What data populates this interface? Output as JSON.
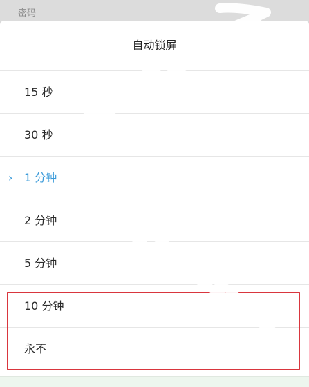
{
  "background": {
    "label": "密码"
  },
  "dialog": {
    "title": "自动锁屏",
    "options": [
      {
        "label": "15 秒",
        "selected": false
      },
      {
        "label": "30 秒",
        "selected": false
      },
      {
        "label": "1 分钟",
        "selected": true
      },
      {
        "label": "2 分钟",
        "selected": false
      },
      {
        "label": "5 分钟",
        "selected": false
      },
      {
        "label": "10 分钟",
        "selected": false
      },
      {
        "label": "永不",
        "selected": false
      }
    ],
    "selected_marker": "›"
  },
  "colors": {
    "accent": "#3a9ad9",
    "highlight_box": "#d9363e",
    "text": "#2a2a2a"
  }
}
